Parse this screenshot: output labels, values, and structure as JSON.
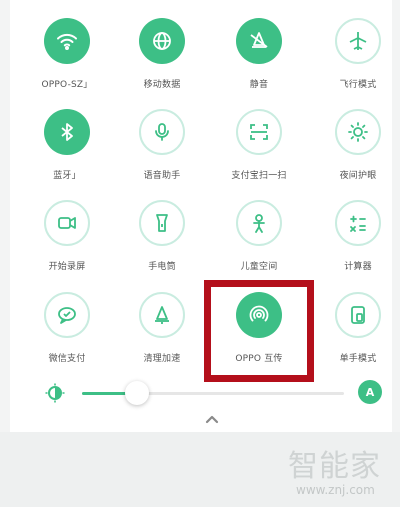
{
  "tiles": [
    {
      "label": "OPPO-SZ」",
      "icon": "wifi-icon",
      "on": true
    },
    {
      "label": "移动数据",
      "icon": "globe-icon",
      "on": true
    },
    {
      "label": "静音",
      "icon": "bell-icon",
      "on": true
    },
    {
      "label": "飞行模式",
      "icon": "airplane-icon",
      "on": false
    },
    {
      "label": "蓝牙」",
      "icon": "bluetooth-icon",
      "on": true
    },
    {
      "label": "语音助手",
      "icon": "microphone-icon",
      "on": false
    },
    {
      "label": "支付宝扫一扫",
      "icon": "scan-icon",
      "on": false
    },
    {
      "label": "夜间护眼",
      "icon": "eye-care-icon",
      "on": false
    },
    {
      "label": "开始录屏",
      "icon": "screen-record-icon",
      "on": false
    },
    {
      "label": "手电筒",
      "icon": "flashlight-icon",
      "on": false
    },
    {
      "label": "儿童空间",
      "icon": "child-icon",
      "on": false
    },
    {
      "label": "计算器",
      "icon": "calculator-icon",
      "on": false
    },
    {
      "label": "微信支付",
      "icon": "wechat-pay-icon",
      "on": false
    },
    {
      "label": "清理加速",
      "icon": "clean-bell-icon",
      "on": false
    },
    {
      "label": "OPPO 互传",
      "icon": "oppo-share-icon",
      "on": true
    },
    {
      "label": "单手模式",
      "icon": "one-hand-icon",
      "on": false
    }
  ],
  "brightness": {
    "level": 0.21,
    "auto_label": "A"
  },
  "colors": {
    "accent": "#3dbf86",
    "highlight": "#b40f1b"
  },
  "watermark": {
    "text": "智能家",
    "url": "www.znj.com"
  }
}
